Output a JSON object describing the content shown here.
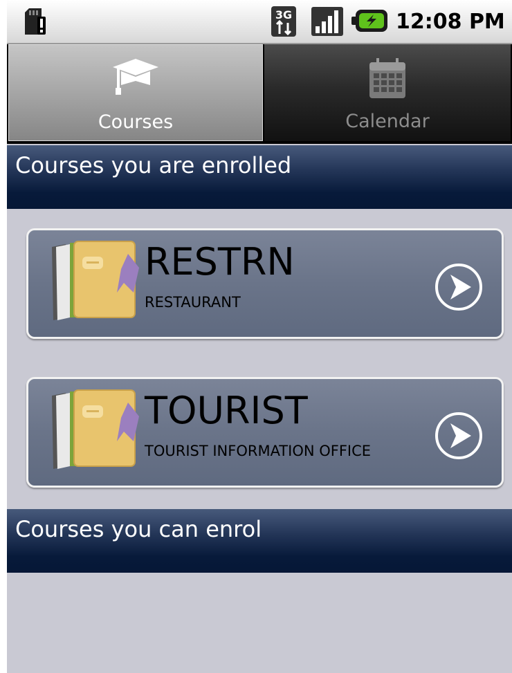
{
  "status_bar": {
    "time": "12:08 PM",
    "network": "3G",
    "icons": [
      "sd-card-alert-icon",
      "3g-data-icon",
      "signal-strength-icon",
      "battery-charging-icon"
    ]
  },
  "tabs": [
    {
      "label": "Courses",
      "icon": "graduation-cap-icon",
      "selected": true
    },
    {
      "label": "Calendar",
      "icon": "calendar-icon",
      "selected": false
    }
  ],
  "sections": {
    "enrolled": {
      "title": "Courses you are enrolled",
      "courses": [
        {
          "code": "RESTRN",
          "name": "RESTAURANT",
          "icon": "course-book-icon",
          "action_icon": "arrow-right-circle-icon"
        },
        {
          "code": "TOURIST",
          "name": "TOURIST INFORMATION OFFICE",
          "icon": "course-book-icon",
          "action_icon": "arrow-right-circle-icon"
        }
      ]
    },
    "can_enrol": {
      "title": "Courses you can enrol",
      "courses": []
    }
  },
  "colors": {
    "header_dark": "#071a3a",
    "card_bg": "#6a7489",
    "background": "#c9c9d3"
  }
}
